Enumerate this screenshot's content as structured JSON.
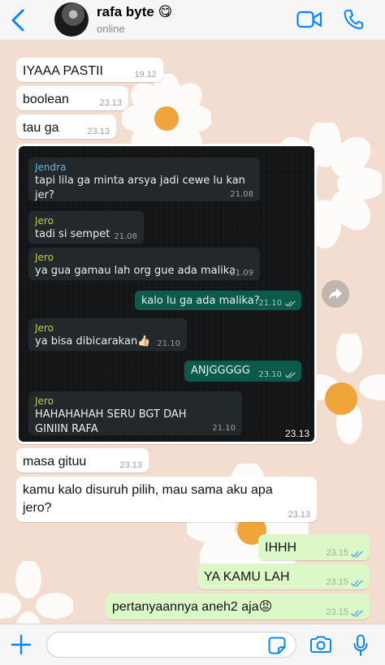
{
  "header": {
    "contact_name": "rafa byte",
    "contact_emoji": "😋",
    "status": "online"
  },
  "colors": {
    "accent": "#0a84ff",
    "wallpaper": "#f3ddd0",
    "incoming": "#ffffff",
    "outgoing": "#dcf8c6",
    "read_tick": "#4fa7e6"
  },
  "messages_top": [
    {
      "text": "IYAAA PASTII",
      "time": "19.12"
    },
    {
      "text": "boolean",
      "time": "23.13"
    },
    {
      "text": "tau ga",
      "time": "23.13"
    }
  ],
  "image_message": {
    "time": "23.13",
    "inner": [
      {
        "sender": "Jendra",
        "text": "tapi lila ga minta arsya jadi cewe lu kan jer?",
        "time": "21.08"
      },
      {
        "sender": "Jero",
        "text": "tadi si sempet",
        "time": "21.08"
      },
      {
        "sender": "Jero",
        "text": "ya gua gamau lah org gue ada malika",
        "time": "21.09"
      },
      {
        "text": "kalo lu ga ada malika?",
        "time": "21.10"
      },
      {
        "sender": "Jero",
        "text": "ya bisa dibicarakan👍🏻",
        "time": "21.10"
      },
      {
        "text": "ANJGGGGG",
        "time": "23.10"
      },
      {
        "sender": "Jero",
        "text": "HAHAHAHAH SERU BGT DAH GINIIN RAFA",
        "time": "21.10"
      }
    ]
  },
  "messages_bottom": [
    {
      "text": "masa gituu",
      "time": "23.13"
    },
    {
      "text": "kamu kalo disuruh pilih, mau sama aku apa jero?",
      "time": "23.13"
    }
  ],
  "messages_out": [
    {
      "text": "IHHH",
      "time": "23.15"
    },
    {
      "text": "YA KAMU LAH",
      "time": "23.15"
    },
    {
      "text": "pertanyaannya aneh2 aja😡",
      "time": "23.15"
    }
  ],
  "icons": {
    "back": "chevron-left-icon",
    "video": "video-camera-icon",
    "call": "phone-icon",
    "forward": "forward-arrow-icon",
    "attach": "plus-icon",
    "sticker": "sticker-icon",
    "camera": "camera-icon",
    "mic": "microphone-icon"
  }
}
